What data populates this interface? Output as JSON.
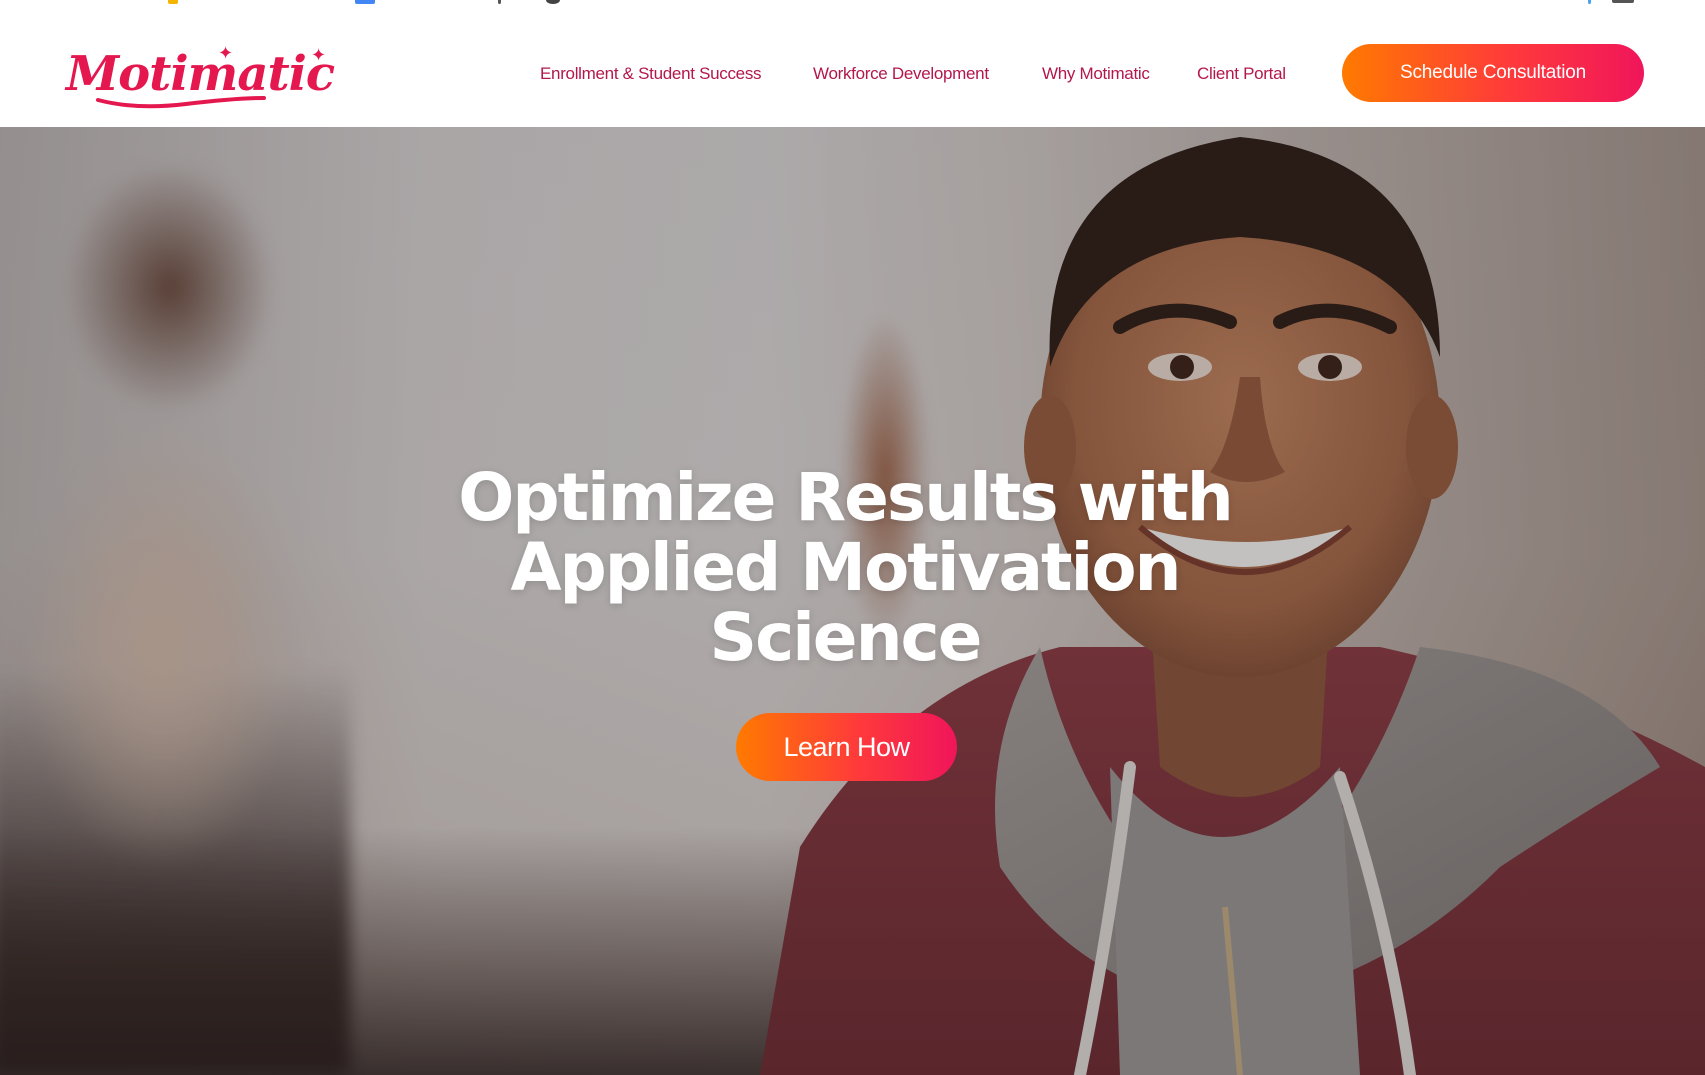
{
  "brand": {
    "name": "Motimatic",
    "color": "#e4174f"
  },
  "nav": {
    "items": [
      {
        "label": "Enrollment & Student Success"
      },
      {
        "label": "Workforce Development"
      },
      {
        "label": "Why Motimatic"
      },
      {
        "label": "Client Portal"
      }
    ],
    "cta_label": "Schedule Consultation"
  },
  "hero": {
    "title": "Optimize Results with Applied Motivation Science",
    "button_label": "Learn How"
  },
  "colors": {
    "nav_text": "#b3174d",
    "gradient_start": "#ff7a00",
    "gradient_end": "#f0155b"
  }
}
